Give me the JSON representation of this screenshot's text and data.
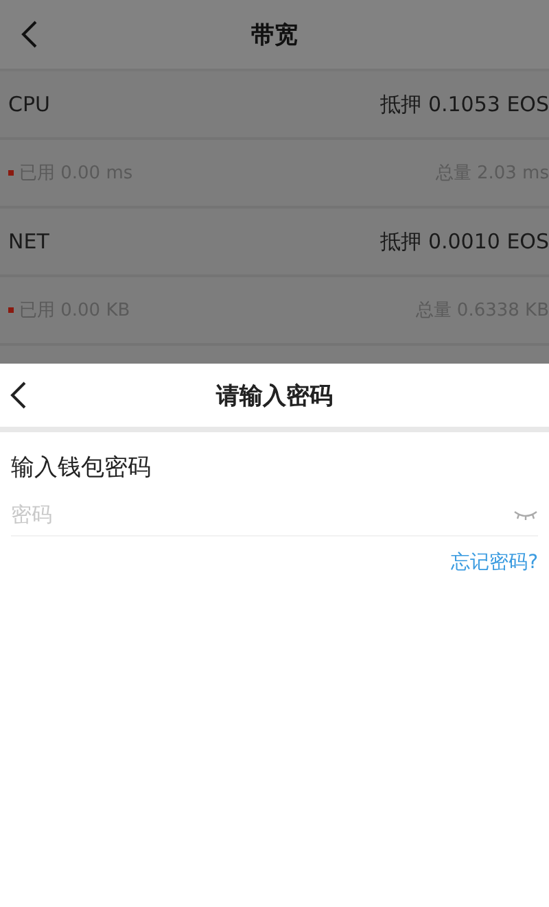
{
  "page": {
    "title": "带宽",
    "resources": [
      {
        "name": "CPU",
        "staked": "抵押 0.1053 EOS",
        "used": "已用 0.00 ms",
        "total": "总量 2.03 ms"
      },
      {
        "name": "NET",
        "staked": "抵押 0.0010 EOS",
        "used": "已用 0.00 KB",
        "total": "总量 0.6338 KB"
      }
    ]
  },
  "dialog": {
    "title": "请输入密码",
    "label": "输入钱包密码",
    "password": {
      "placeholder": "密码"
    },
    "forgot_link": "忘记密码?"
  }
}
